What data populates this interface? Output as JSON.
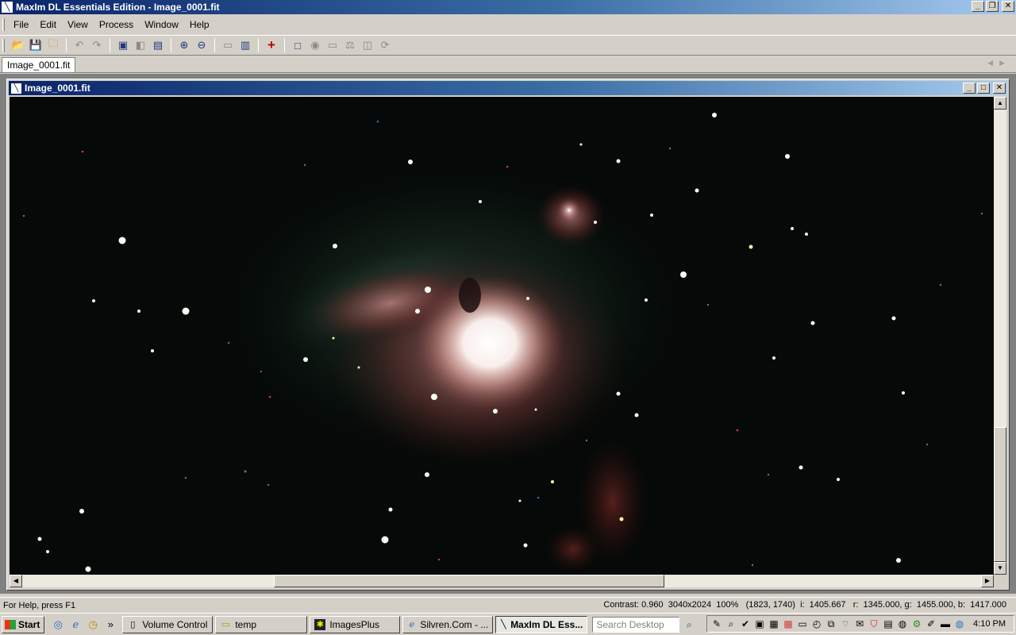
{
  "app": {
    "title": "MaxIm DL Essentials Edition - Image_0001.fit",
    "icon": "maxim-app-icon"
  },
  "window_buttons": {
    "minimize": "_",
    "restore": "❐",
    "close": "✕"
  },
  "menu": [
    {
      "label": "File",
      "key": "F"
    },
    {
      "label": "Edit",
      "key": "E"
    },
    {
      "label": "View",
      "key": "V"
    },
    {
      "label": "Process",
      "key": "P"
    },
    {
      "label": "Window",
      "key": "W"
    },
    {
      "label": "Help",
      "key": "H"
    }
  ],
  "toolbar": {
    "icons": [
      "open-folder-icon",
      "save-icon",
      "new-icon",
      "undo-icon",
      "redo-icon",
      "image-icon",
      "stretch-icon",
      "properties-icon",
      "zoom-in-icon",
      "zoom-out-icon",
      "ruler-icon",
      "histogram-icon",
      "crosshair-icon",
      "select-rect-icon",
      "eye-icon",
      "screen-icon",
      "balance-icon",
      "process-icon",
      "rotate-icon"
    ]
  },
  "doc_tabs": [
    {
      "label": "Image_0001.fit"
    }
  ],
  "child_window": {
    "title": "Image_0001.fit",
    "image_alt": "Orion Nebula (M42) astrophotograph"
  },
  "statusbar": {
    "help": "For Help, press F1",
    "info": "Contrast: 0.960  3040x2024  100%   (1823, 1740)  i:  1405.667   r:  1345.000, g:  1455.000, b:  1417.000"
  },
  "taskbar": {
    "start": "Start",
    "quicklaunch_more": "»",
    "tasks": [
      {
        "label": "Volume Control",
        "icon": "speaker-icon",
        "active": false
      },
      {
        "label": "temp",
        "icon": "folder-icon",
        "active": false
      },
      {
        "label": "ImagesPlus",
        "icon": "imagesplus-icon",
        "active": false
      },
      {
        "label": "Silvren.Com - ...",
        "icon": "browser-icon",
        "active": false
      },
      {
        "label": "MaxIm DL Ess...",
        "icon": "maxim-app-icon",
        "active": true
      }
    ],
    "search_placeholder": "Search Desktop",
    "clock": "4:10 PM"
  }
}
